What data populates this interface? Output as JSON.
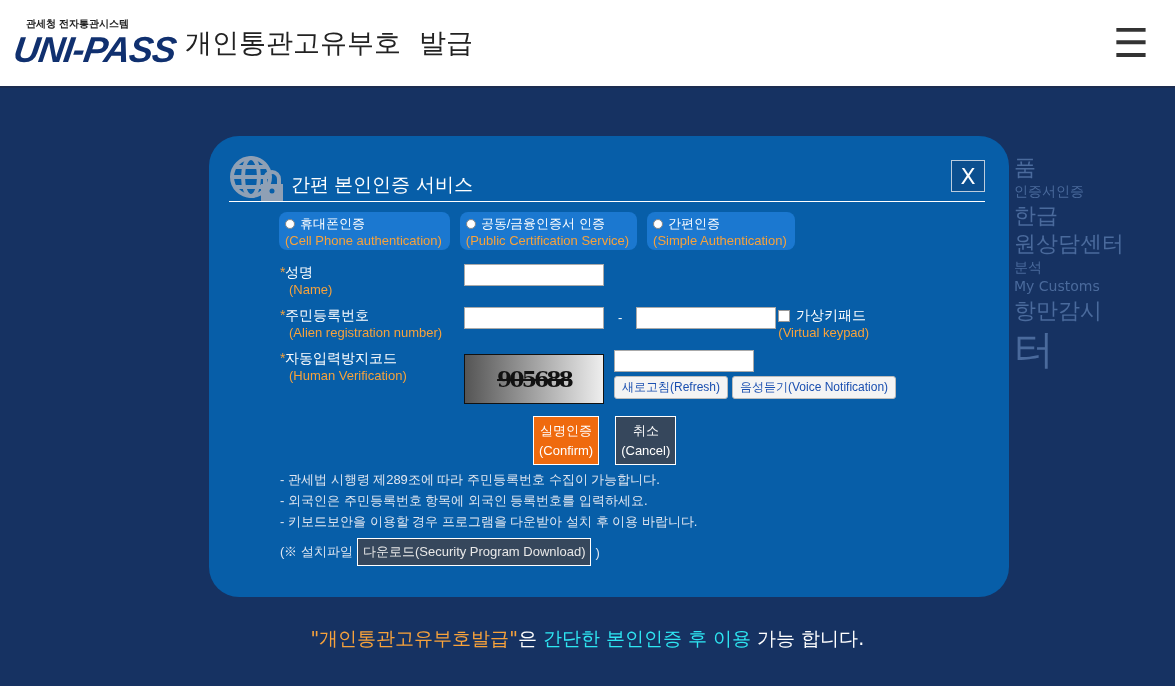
{
  "header": {
    "logo_caption": "관세청 전자통관시스템",
    "logo_text": "UNI-PASS",
    "title": "개인통관고유부호  발급",
    "menu_icon": "☰"
  },
  "background_texts": [
    {
      "text": "품",
      "kind": "large"
    },
    {
      "text": "인증서인증",
      "kind": "medium"
    },
    {
      "text": "한급",
      "kind": "large"
    },
    {
      "text": "원상담센터",
      "kind": "large"
    },
    {
      "text": "분석",
      "kind": "medium"
    },
    {
      "text": "My Customs",
      "kind": "medium"
    },
    {
      "text": "항만감시",
      "kind": "large"
    },
    {
      "text": "터",
      "kind": "huge"
    }
  ],
  "modal": {
    "title": "간편 본인인증 서비스",
    "close": "X",
    "methods": [
      {
        "label": "휴대폰인증",
        "sublabel": "(Cell Phone authentication)",
        "selected": false
      },
      {
        "label": "공동/금융인증서 인증",
        "sublabel": "(Public Certification Service)",
        "selected": false
      },
      {
        "label": "간편인증",
        "sublabel": "(Simple Authentication)",
        "selected": false
      }
    ],
    "fields": [
      {
        "kind": "text",
        "label": "성명",
        "sublabel": "(Name)"
      },
      {
        "kind": "id",
        "label": "주민등록번호",
        "sublabel": "(Alien registration number)",
        "separator": "-",
        "keypad": {
          "label": "가상키패드",
          "sublabel": "(Virtual keypad)",
          "checked": false
        }
      },
      {
        "kind": "captcha",
        "label": "자동입력방지코드",
        "sublabel": "(Human Verification)",
        "captcha": "905688",
        "buttons": [
          "새로고침(Refresh)",
          "음성듣기(Voice Notification)"
        ]
      }
    ],
    "required_mark": "*",
    "confirm": {
      "label": "실명인증",
      "sublabel": "(Confirm)"
    },
    "cancel": {
      "label": "취소",
      "sublabel": "(Cancel)"
    },
    "notes": [
      "- 관세법 시행령 제289조에 따라 주민등록번호 수집이 가능합니다.",
      "- 외국인은 주민등록번호 항목에 외국인 등록번호를 입력하세요.",
      "- 키보드보안을 이용할 경우 프로그램을 다운받아 설치 후 이용 바랍니다."
    ],
    "download": {
      "prefix": "(※ 설치파일",
      "button": "다운로드(Security Program Download)",
      "suffix": ")"
    }
  },
  "footer": [
    {
      "kind": "quote",
      "text": "\"개인통관고유부호발급\""
    },
    {
      "kind": "plain",
      "text": "은 "
    },
    {
      "kind": "highlight",
      "text": "간단한 본인인증 후 이용"
    },
    {
      "kind": "plain",
      "text": " 가능 합니다."
    }
  ]
}
